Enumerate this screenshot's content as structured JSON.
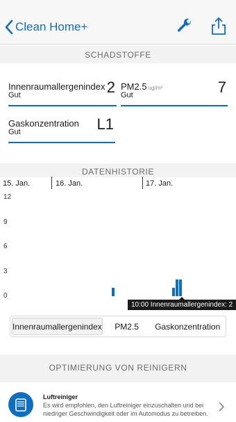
{
  "nav": {
    "back_label": "Clean Home+",
    "icons": [
      "chevron-left-icon",
      "wrench-icon",
      "share-icon"
    ],
    "accent": "#0f6fbf"
  },
  "pollutants": {
    "title": "SCHADSTOFFE",
    "cards": [
      {
        "name": "Innenraumallergenindex",
        "unit": "",
        "status": "Gut",
        "value": "2"
      },
      {
        "name": "PM2.5",
        "unit": "ug/m³",
        "status": "Gut",
        "value": "7"
      },
      {
        "name": "Gaskonzentration",
        "unit": "",
        "status": "Gut",
        "value": "L1"
      }
    ]
  },
  "history": {
    "title": "DATENHISTORIE",
    "dates": [
      "15. Jan.",
      "16. Jan.",
      "17. Jan."
    ],
    "y_ticks": [
      "12",
      "9",
      "6",
      "3",
      "0"
    ],
    "tooltip": "10:00 Innenraumallergenindex: 2",
    "tabs": [
      "Innenraumallergenindex",
      "PM2.5",
      "Gaskonzentration"
    ],
    "active_tab": "Innenraumallergenindex"
  },
  "chart_data": {
    "type": "bar",
    "title": "",
    "xlabel": "",
    "ylabel": "",
    "ylim": [
      0,
      12
    ],
    "yticks": [
      0,
      3,
      6,
      9,
      12
    ],
    "x_categories": [
      "15. Jan.",
      "16. Jan.",
      "17. Jan."
    ],
    "series": [
      {
        "values": [
          {
            "day": "16. Jan.",
            "value": 1
          },
          {
            "day": "17. Jan.",
            "value": 1
          },
          {
            "day": "17. Jan.",
            "value": 2
          },
          {
            "day": "17. Jan.",
            "value": 2
          }
        ]
      }
    ],
    "grid": false
  },
  "optimization": {
    "title": "OPTIMIERUNG VON REINIGERN",
    "card_title": "Luftreiniger",
    "card_text": "Es wird empfohlen, den Luftreiniger einzuschalten und bei niedriger Geschwindigkeit oder im Automodus zu betreiben."
  }
}
